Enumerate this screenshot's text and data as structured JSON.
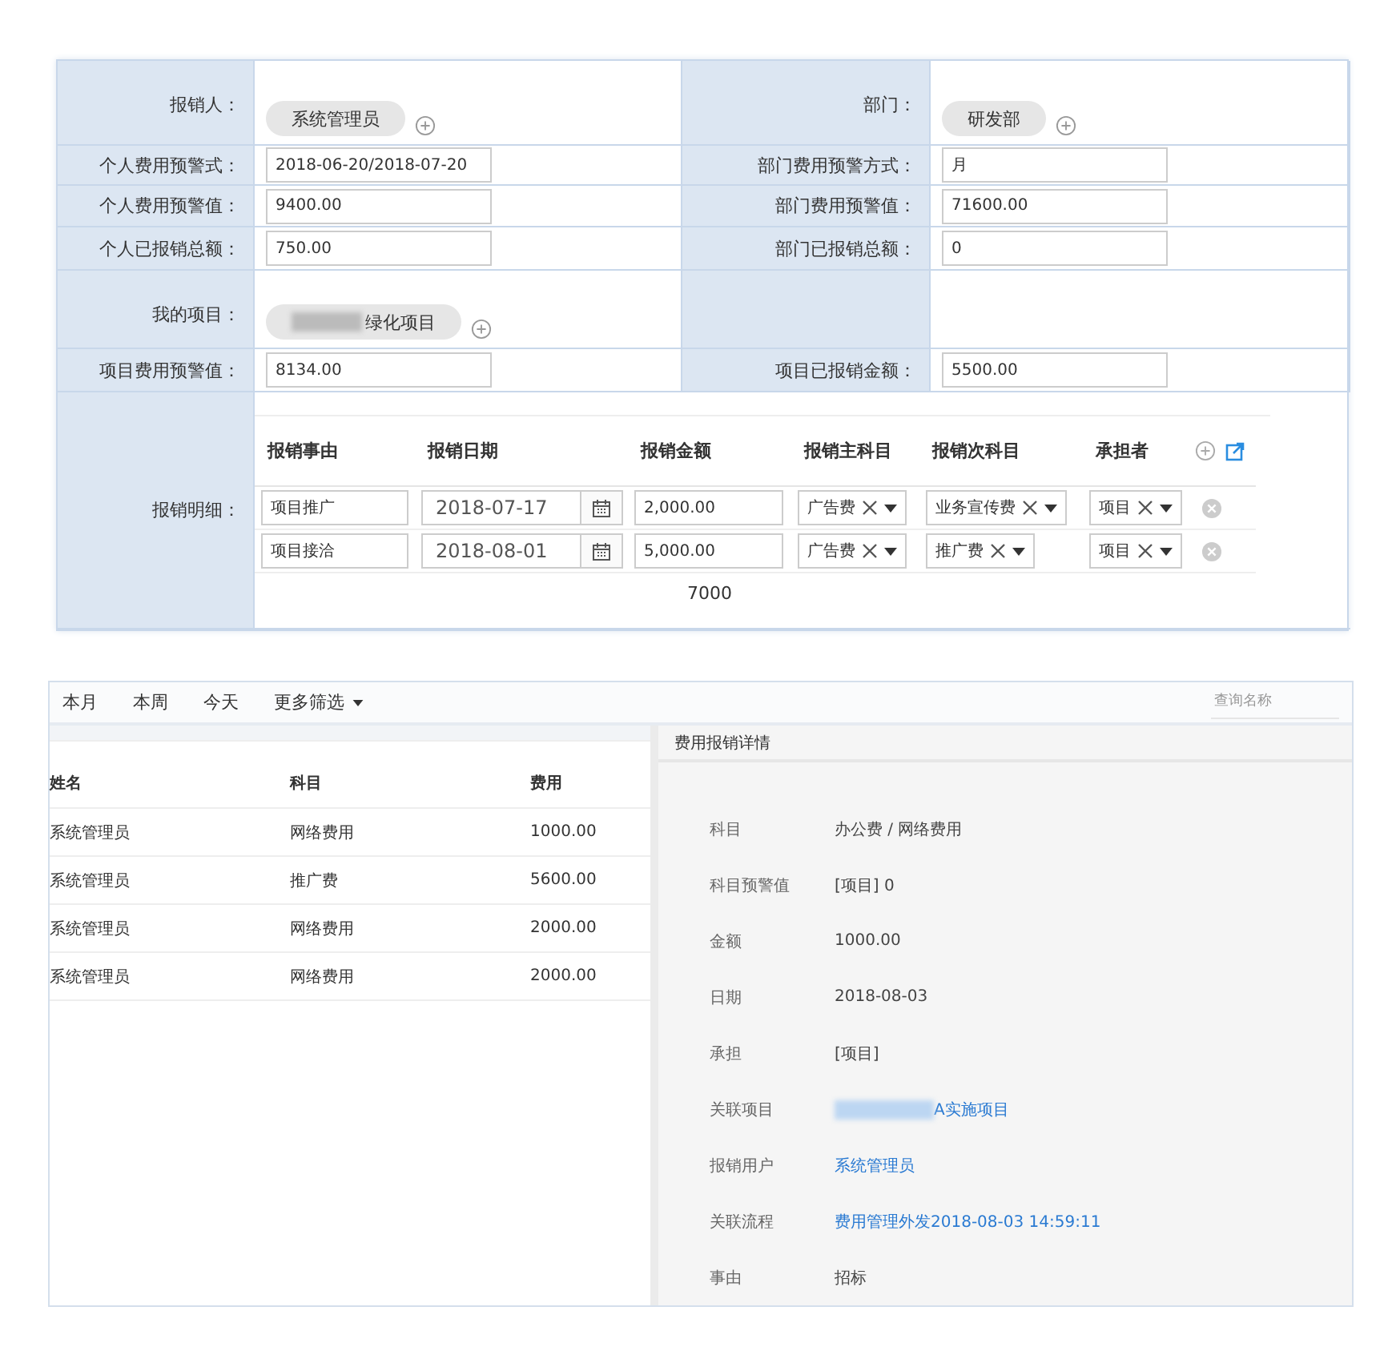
{
  "form": {
    "rows": [
      {
        "cells": [
          {
            "label": "报销人：",
            "kind": "tag",
            "value": "系统管理员",
            "redacted": false
          },
          {
            "label": "部门：",
            "kind": "tag",
            "value": "研发部",
            "redacted": false
          }
        ]
      },
      {
        "cells": [
          {
            "label": "个人费用预警式：",
            "kind": "input",
            "value": "2018-06-20/2018-07-20"
          },
          {
            "label": "部门费用预警方式：",
            "kind": "input",
            "value": "月"
          }
        ]
      },
      {
        "cells": [
          {
            "label": "个人费用预警值：",
            "kind": "input",
            "value": "9400.00"
          },
          {
            "label": "部门费用预警值：",
            "kind": "input",
            "value": "71600.00"
          }
        ]
      },
      {
        "cells": [
          {
            "label": "个人已报销总额：",
            "kind": "input",
            "value": "750.00"
          },
          {
            "label": "部门已报销总额：",
            "kind": "input",
            "value": "0"
          }
        ]
      },
      {
        "cells": [
          {
            "label": "我的项目：",
            "kind": "tag",
            "value": "绿化项目",
            "redacted": true
          },
          {
            "kind": "empty"
          }
        ]
      },
      {
        "cells": [
          {
            "label": "项目费用预警值：",
            "kind": "input",
            "value": "8134.00"
          },
          {
            "label": "项目已报销金额：",
            "kind": "input",
            "value": "5500.00"
          }
        ]
      }
    ]
  },
  "details": {
    "label": "报销明细：",
    "columns": [
      "报销事由",
      "报销日期",
      "报销金额",
      "报销主科目",
      "报销次科目",
      "承担者"
    ],
    "rows": [
      {
        "reason": "项目推广",
        "date": "2018-07-17",
        "amount": "2,000.00",
        "main": "广告费",
        "sub": "业务宣传费",
        "bearer": "项目"
      },
      {
        "reason": "项目接洽",
        "date": "2018-08-01",
        "amount": "5,000.00",
        "main": "广告费",
        "sub": "推广费",
        "bearer": "项目"
      }
    ],
    "total": "7000"
  },
  "filters": [
    {
      "label": "本月",
      "kind": "plain"
    },
    {
      "label": "本周",
      "kind": "plain"
    },
    {
      "label": "今天",
      "kind": "plain"
    },
    {
      "label": "更多筛选",
      "kind": "dropdown"
    }
  ],
  "search": {
    "placeholder": "查询名称"
  },
  "list": {
    "columns": [
      "姓名",
      "科目",
      "费用"
    ],
    "rows": [
      [
        "系统管理员",
        "网络费用",
        "1000.00"
      ],
      [
        "系统管理员",
        "推广费",
        "5600.00"
      ],
      [
        "系统管理员",
        "网络费用",
        "2000.00"
      ],
      [
        "系统管理员",
        "网络费用",
        "2000.00"
      ]
    ]
  },
  "detail": {
    "title": "费用报销详情",
    "fields": [
      {
        "label": "科目",
        "value": "办公费 / 网络费用",
        "kind": "text"
      },
      {
        "label": "科目预警值",
        "value": "[项目] 0",
        "kind": "text"
      },
      {
        "label": "金额",
        "value": "1000.00",
        "kind": "text"
      },
      {
        "label": "日期",
        "value": "2018-08-03",
        "kind": "text"
      },
      {
        "label": "承担",
        "value": "[项目]",
        "kind": "text"
      },
      {
        "label": "关联项目",
        "value": "A实施项目",
        "kind": "link",
        "redacted": true
      },
      {
        "label": "报销用户",
        "value": "系统管理员",
        "kind": "link",
        "redacted": false
      },
      {
        "label": "关联流程",
        "value": "费用管理外发2018-08-03 14:59:11",
        "kind": "link",
        "redacted": false
      },
      {
        "label": "事由",
        "value": "招标",
        "kind": "text"
      }
    ]
  }
}
